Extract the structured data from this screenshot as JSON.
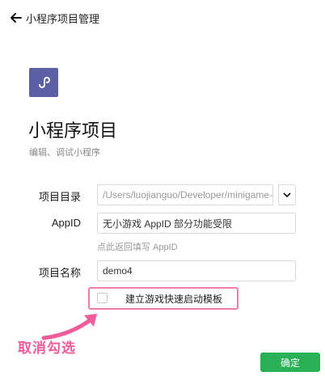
{
  "header": {
    "title": "小程序项目管理",
    "back_icon": "arrow-left-icon"
  },
  "project": {
    "logo_icon": "miniprogram-logo-icon",
    "title": "小程序项目",
    "subtitle": "编辑、调试小程序"
  },
  "form": {
    "directory": {
      "label": "项目目录",
      "value": "/Users/luojianguo/Developer/minigame-demo"
    },
    "appid": {
      "label": "AppID",
      "value": "无小游戏 AppID 部分功能受限",
      "hint": "点此返回填写 AppID"
    },
    "name": {
      "label": "项目名称",
      "value": "demo4"
    },
    "template_checkbox": {
      "label": "建立游戏快速启动模板",
      "checked": false
    }
  },
  "annotation": {
    "text": "取消勾选",
    "color": "#ef5c9b"
  },
  "footer": {
    "confirm_label": "确定"
  },
  "colors": {
    "brand_logo": "#5c5fa3",
    "confirm": "#2ab055",
    "highlight": "#f07ab0"
  }
}
